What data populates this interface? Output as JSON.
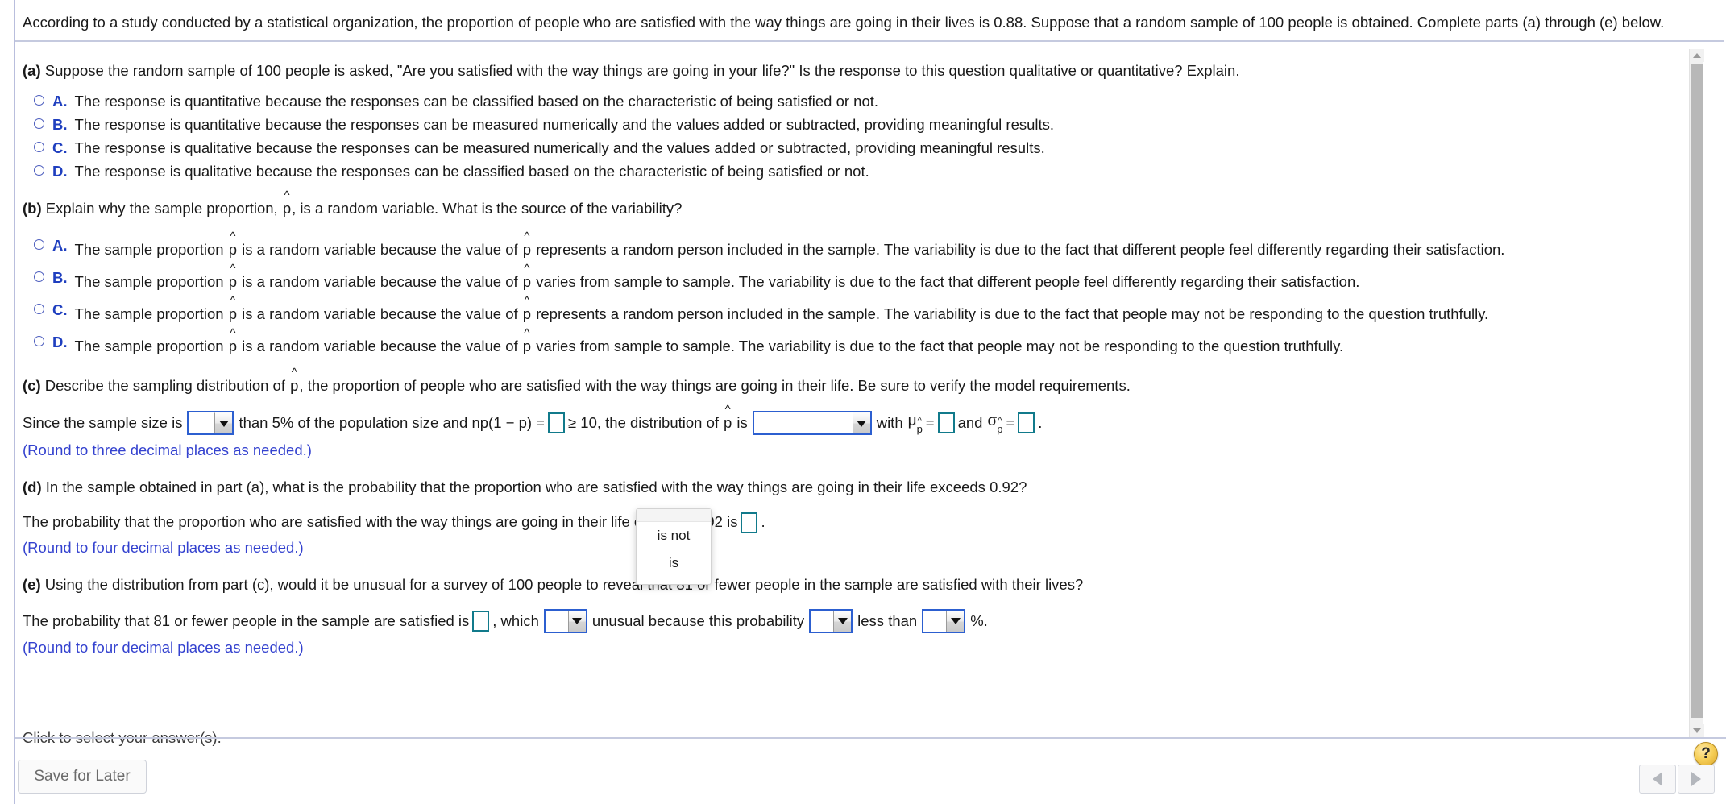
{
  "statement": {
    "text": "According to a study conducted by a statistical organization, the proportion of people who are satisfied with the way things are going in their lives is 0.88. Suppose that a random sample of 100 people is obtained. Complete parts (a) through (e) below."
  },
  "parts": {
    "a": {
      "label": "(a)",
      "prompt": "Suppose the random sample of 100 people is asked, \"Are you satisfied with the way things are going in your life?\" Is the response to this question qualitative or quantitative? Explain.",
      "choices": [
        {
          "letter": "A.",
          "text": "The response is quantitative because the responses can be classified based on the characteristic of being satisfied or not."
        },
        {
          "letter": "B.",
          "text": "The response is quantitative because the responses can be measured numerically and the values added or subtracted, providing meaningful results."
        },
        {
          "letter": "C.",
          "text": "The response is qualitative because the responses can be measured numerically and the values added or subtracted, providing meaningful results."
        },
        {
          "letter": "D.",
          "text": "The response is qualitative because the responses can be classified based on the characteristic of being satisfied or not."
        }
      ]
    },
    "b": {
      "label": "(b)",
      "prompt_pre": "Explain why the sample proportion, ",
      "prompt_post": ", is a random variable. What is the source of the variability?",
      "choices": [
        {
          "letter": "A.",
          "t1": "The sample proportion ",
          "t2": " is a random variable because the value of ",
          "t3": " represents a random person included in the sample. The variability is due to the fact that different people feel differently regarding their satisfaction."
        },
        {
          "letter": "B.",
          "t1": "The sample proportion ",
          "t2": " is a random variable because the value of ",
          "t3": " varies from sample to sample. The variability is due to the fact that different people feel differently regarding their satisfaction."
        },
        {
          "letter": "C.",
          "t1": "The sample proportion ",
          "t2": " is a random variable because the value of ",
          "t3": " represents a random person included in the sample. The variability is due to the fact that people may not be responding to the question truthfully."
        },
        {
          "letter": "D.",
          "t1": "The sample proportion ",
          "t2": " is a random variable because the value of ",
          "t3": " varies from sample to sample. The variability is due to the fact that people may not be responding to the question truthfully."
        }
      ]
    },
    "c": {
      "label": "(c)",
      "prompt_pre": "Describe the sampling distribution of ",
      "prompt_post": ", the proportion of people who are satisfied with the way things are going in their life. Be sure to verify the model requirements.",
      "row": {
        "s1": "Since the sample size is",
        "s2": "than 5% of the population size and np(1 − p) =",
        "s3": "≥ 10, the distribution of",
        "s4": "is",
        "s5": "with",
        "mu_base": "μ",
        "mu_sub": "p",
        "eq1": "=",
        "s6": "and",
        "sigma_base": "σ",
        "sigma_sub": "p",
        "eq2": "=",
        "period": "."
      },
      "note": "(Round to three decimal places as needed.)",
      "entry_values": {
        "np": "",
        "mu": "",
        "sigma": ""
      },
      "dropdown_values": {
        "size_compare": "",
        "distribution_shape": ""
      }
    },
    "d": {
      "label": "(d)",
      "prompt": "In the sample obtained in part (a), what is the probability that the proportion who are satisfied with the way things are going in their life exceeds 0.92?",
      "answer_pre": "The probability that the proportion who are satisfied with the way things are going in their life exceeds 0.92 is",
      "answer_post": ".",
      "entry_value": "",
      "note": "(Round to four decimal places as needed.)"
    },
    "e": {
      "label": "(e)",
      "prompt": "Using the distribution from part (c), would it be unusual for a survey of 100 people to reveal that 81 or fewer people in the sample are satisfied with their lives?",
      "answer_s1": "The probability that 81 or fewer people in the sample are satisfied is",
      "answer_s2": ", which",
      "answer_s3": "unusual because this probability",
      "answer_s4": "less than",
      "answer_s5": "%.",
      "entry_value": "",
      "dropdown_values": {
        "is_unusual": "",
        "comparison": "",
        "percent": ""
      },
      "note": "(Round to four decimal places as needed.)"
    }
  },
  "open_dropdown": {
    "options": [
      "is not",
      "is"
    ]
  },
  "footer": {
    "click_hint": "Click to select your answer(s).",
    "save_label": "Save for Later",
    "help_label": "?"
  },
  "colors": {
    "accent_blue": "#2c5fd0",
    "entry_teal": "#117a8b",
    "note_blue": "#3442cf",
    "letter_blue": "#1f3fbf",
    "help_yellow": "#f6cf58"
  }
}
